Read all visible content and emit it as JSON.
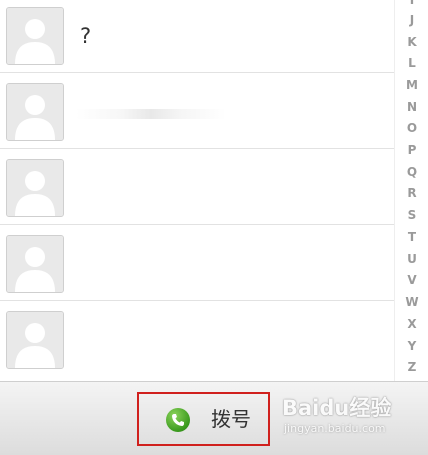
{
  "contacts": [
    {
      "name": "?"
    },
    {
      "name": ""
    },
    {
      "name": ""
    },
    {
      "name": ""
    },
    {
      "name": ""
    }
  ],
  "index_letters": [
    "I",
    "J",
    "K",
    "L",
    "M",
    "N",
    "O",
    "P",
    "Q",
    "R",
    "S",
    "T",
    "U",
    "V",
    "W",
    "X",
    "Y",
    "Z"
  ],
  "toolbar": {
    "dial_label": "拨号"
  },
  "watermark": {
    "logo_text": "Baidu经验",
    "url": "jingyan.baidu.com"
  },
  "colors": {
    "highlight_border": "#d0201d",
    "phone_icon": "#3a9a1e",
    "index_letter": "#9a9a9a"
  }
}
